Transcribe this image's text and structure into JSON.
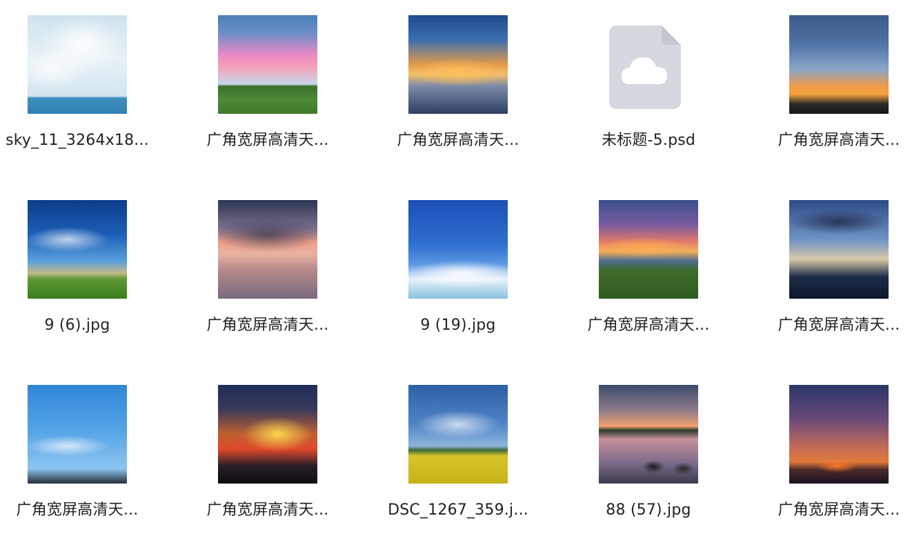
{
  "files": [
    {
      "label": "sky_11_3264x18...",
      "thumb": "t-sky11"
    },
    {
      "label": "广角宽屏高清天...",
      "thumb": "t-pinkhill"
    },
    {
      "label": "广角宽屏高清天...",
      "thumb": "t-sunset-sea"
    },
    {
      "label": "未标题-5.psd",
      "thumb": "psd-cloud-icon"
    },
    {
      "label": "广角宽屏高清天...",
      "thumb": "t-sunset-orange"
    },
    {
      "label": "9 (6).jpg",
      "thumb": "t-blue-house"
    },
    {
      "label": "广角宽屏高清天...",
      "thumb": "t-pinklake"
    },
    {
      "label": "9 (19).jpg",
      "thumb": "t-bluefish"
    },
    {
      "label": "广角宽屏高清天...",
      "thumb": "t-castle"
    },
    {
      "label": "广角宽屏高清天...",
      "thumb": "t-darkblue"
    },
    {
      "label": "广角宽屏高清天...",
      "thumb": "t-softblue"
    },
    {
      "label": "广角宽屏高清天...",
      "thumb": "t-firesky"
    },
    {
      "label": "DSC_1267_359.j...",
      "thumb": "t-rapefield"
    },
    {
      "label": "88 (57).jpg",
      "thumb": "t-rocks"
    },
    {
      "label": "广角宽屏高清天...",
      "thumb": "t-redsunset"
    }
  ]
}
